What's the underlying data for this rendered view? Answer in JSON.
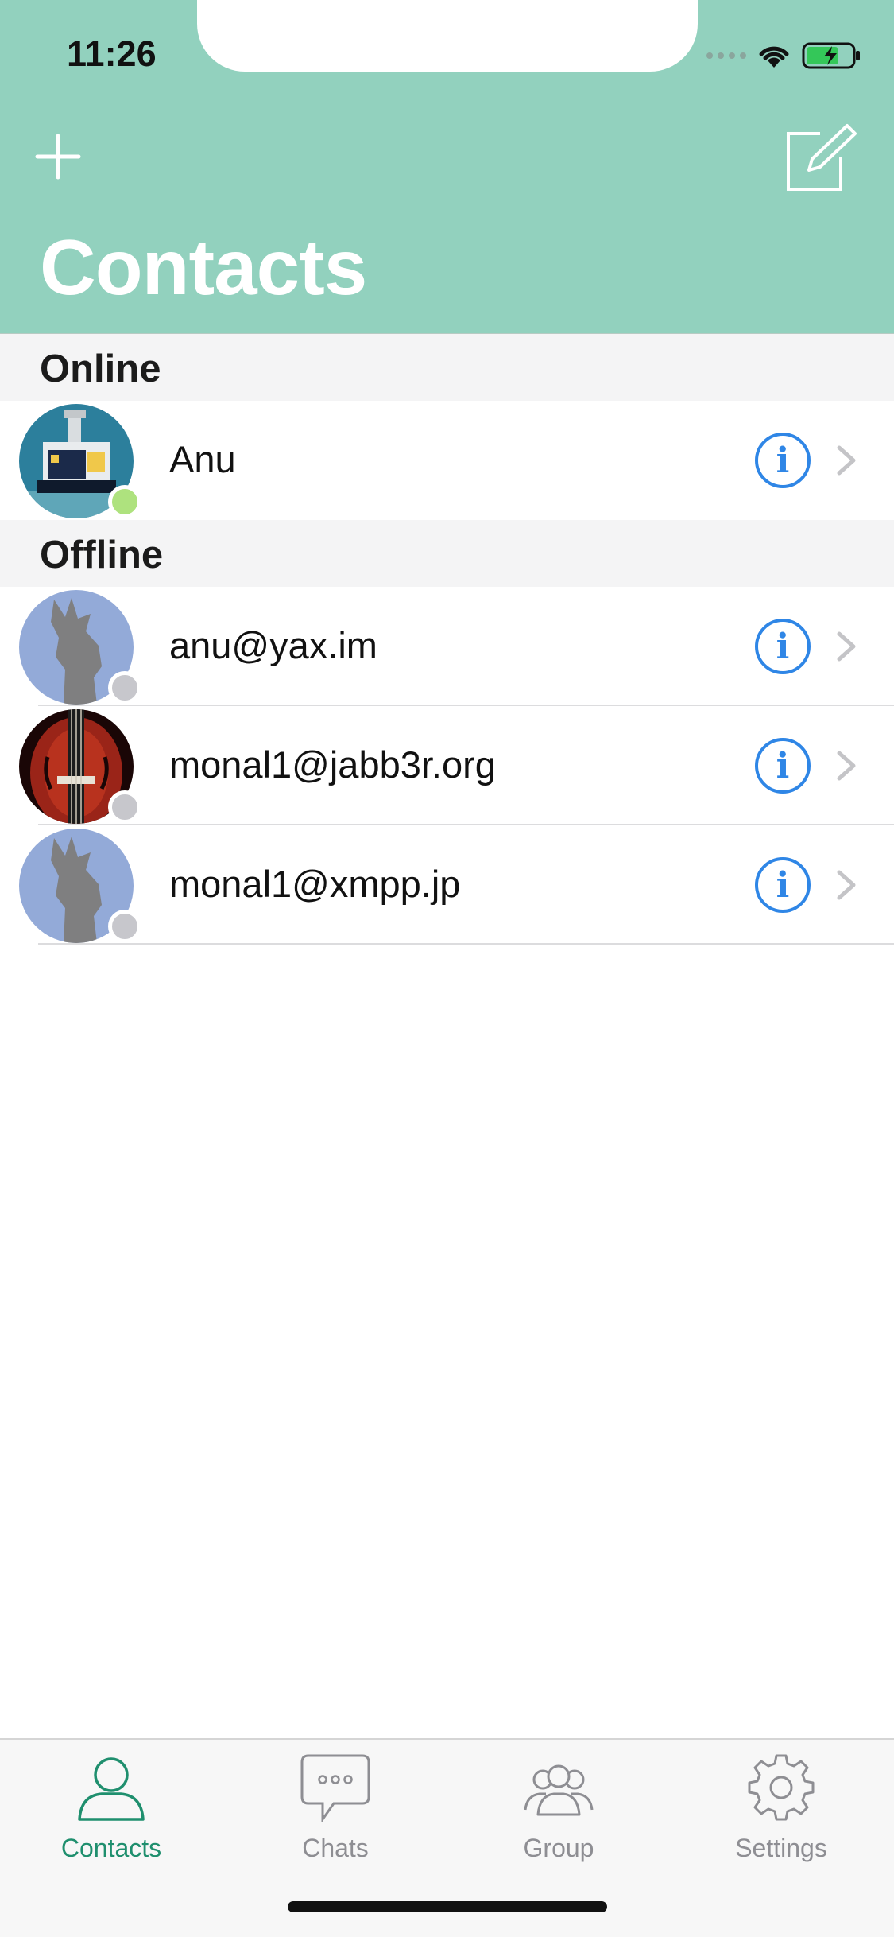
{
  "status_bar": {
    "time": "11:26"
  },
  "header": {
    "title": "Contacts",
    "add_icon": "plus-icon",
    "compose_icon": "compose-icon"
  },
  "sections": [
    {
      "title": "Online",
      "contacts": [
        {
          "name": "Anu",
          "presence": "online",
          "avatar": "robot-avatar"
        }
      ]
    },
    {
      "title": "Offline",
      "contacts": [
        {
          "name": "anu@yax.im",
          "presence": "offline",
          "avatar": "default-avatar"
        },
        {
          "name": "monal1@jabb3r.org",
          "presence": "offline",
          "avatar": "violin-avatar"
        },
        {
          "name": "monal1@xmpp.jp",
          "presence": "offline",
          "avatar": "default-avatar"
        }
      ]
    }
  ],
  "tabs": [
    {
      "label": "Contacts",
      "icon": "person-icon",
      "active": true
    },
    {
      "label": "Chats",
      "icon": "chat-bubble-icon",
      "active": false
    },
    {
      "label": "Group",
      "icon": "group-icon",
      "active": false
    },
    {
      "label": "Settings",
      "icon": "gear-icon",
      "active": false
    }
  ],
  "colors": {
    "header_bg": "#92d1be",
    "accent_blue": "#2f86e6",
    "active_tab": "#1f8f6e",
    "online": "#aee27e",
    "offline": "#c7c7cc"
  }
}
